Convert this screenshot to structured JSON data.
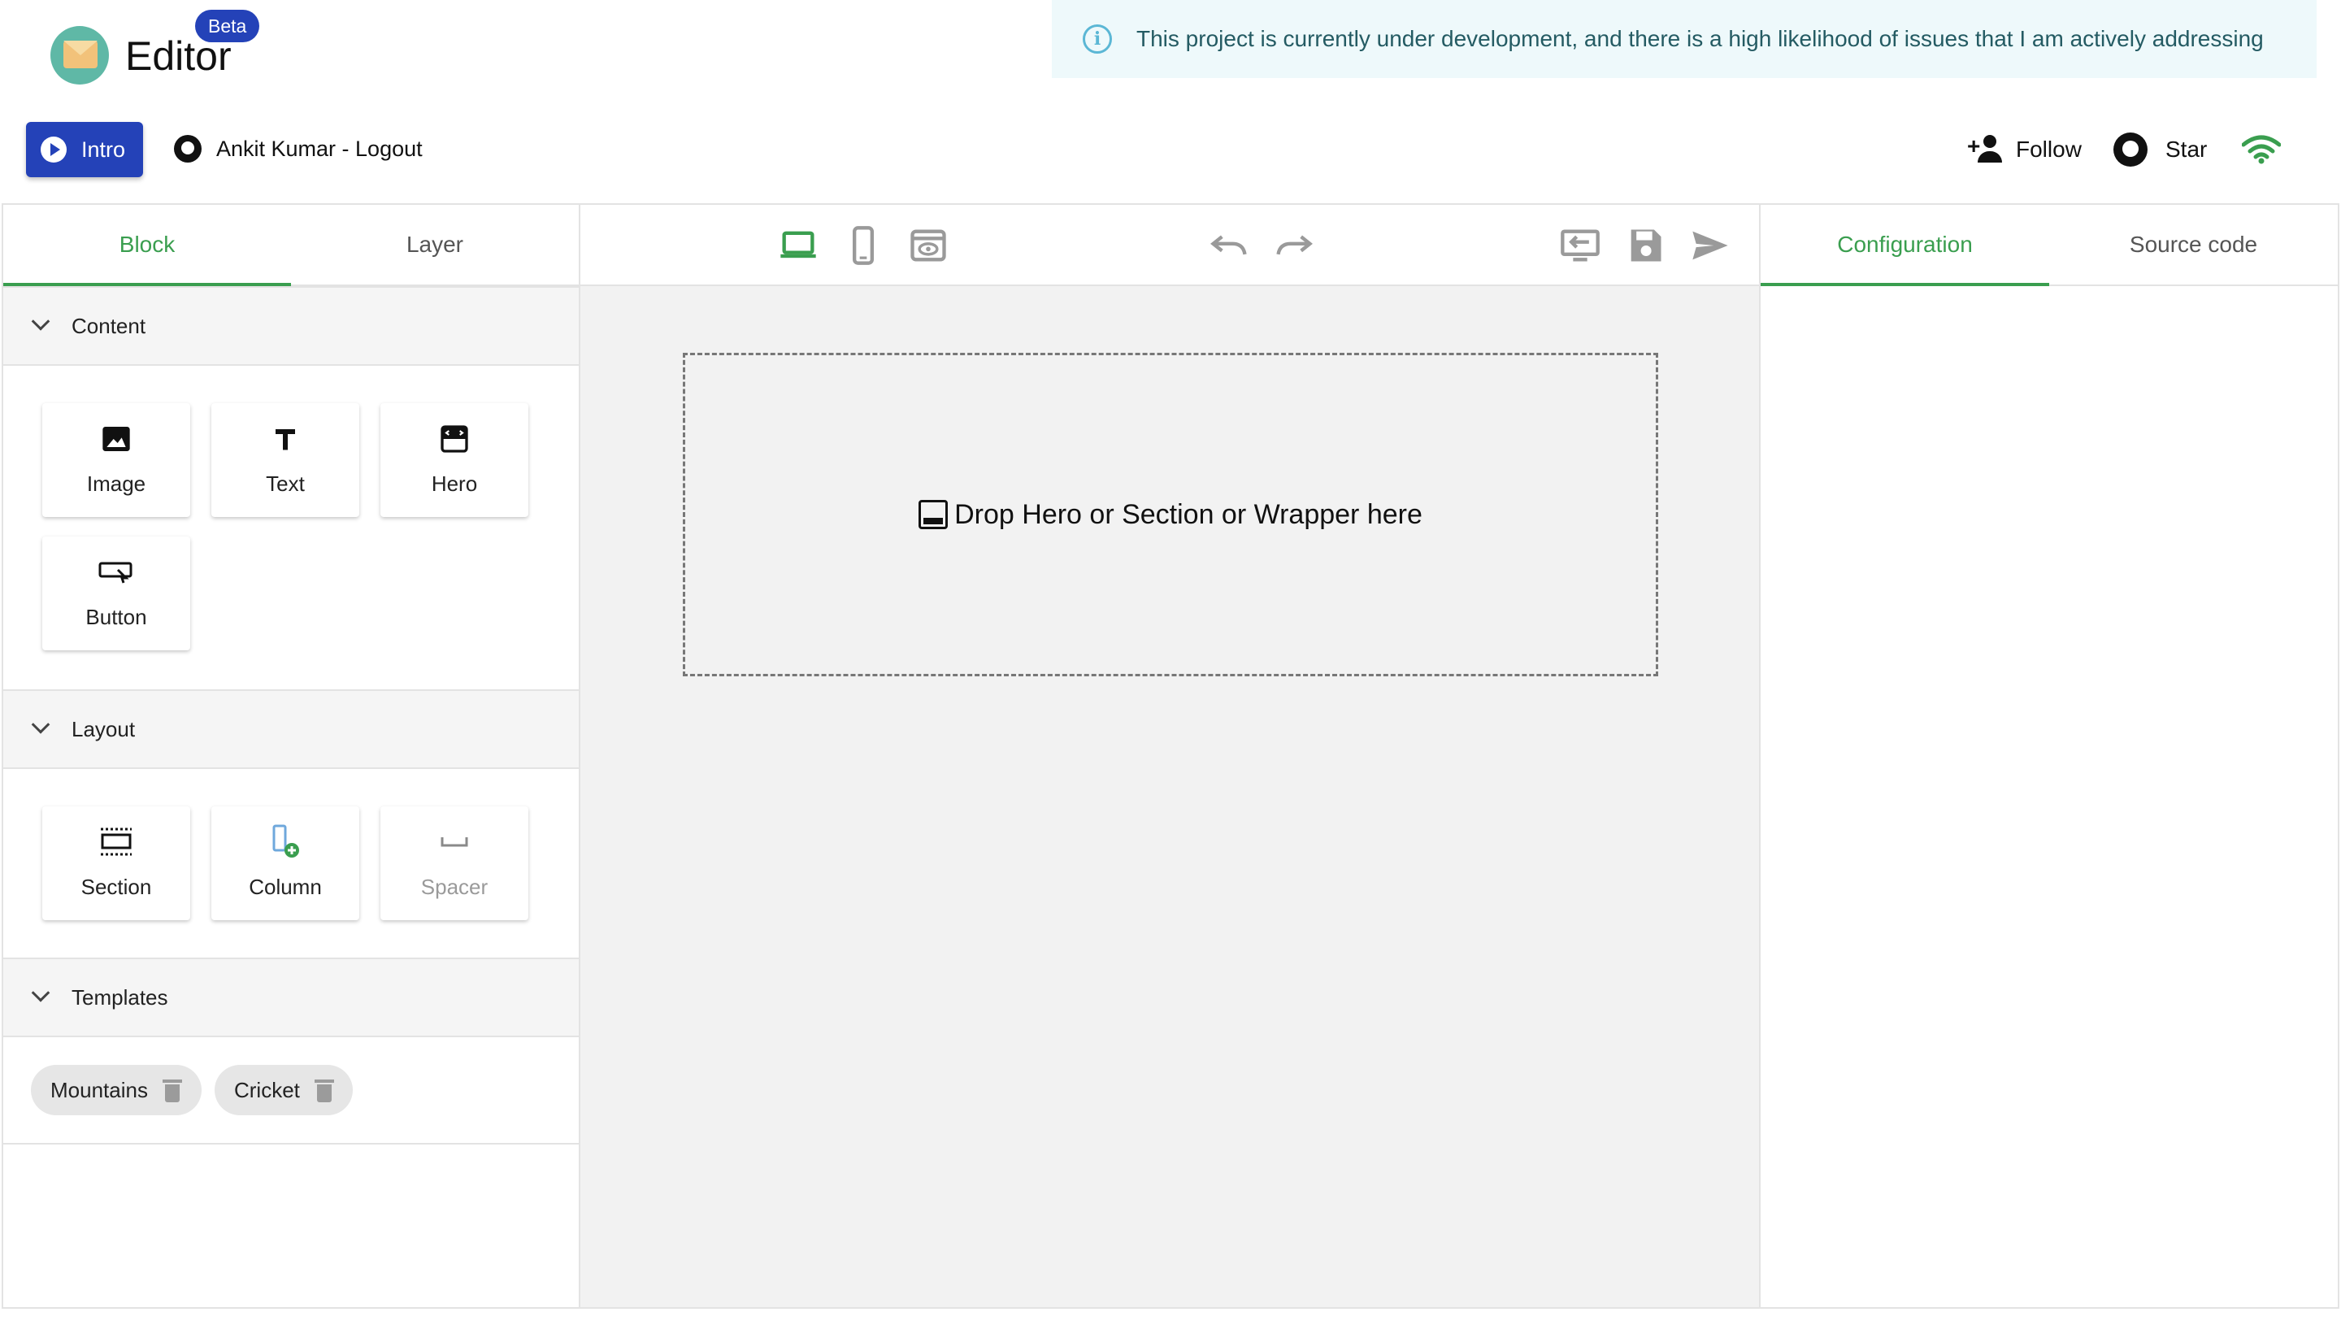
{
  "header": {
    "app_title": "Editor",
    "beta_badge": "Beta",
    "banner_text": "This project is currently under development, and there is a high likelihood of issues that I am actively addressing",
    "intro_label": "Intro",
    "user_link": "Ankit Kumar - Logout",
    "follow_label": "Follow",
    "star_label": "Star"
  },
  "left_panel": {
    "tabs": [
      {
        "label": "Block",
        "active": true
      },
      {
        "label": "Layer",
        "active": false
      }
    ],
    "sections": {
      "content": {
        "label": "Content",
        "items": [
          {
            "label": "Image",
            "icon": "image-icon"
          },
          {
            "label": "Text",
            "icon": "text-icon"
          },
          {
            "label": "Hero",
            "icon": "hero-icon"
          },
          {
            "label": "Button",
            "icon": "button-icon"
          }
        ]
      },
      "layout": {
        "label": "Layout",
        "items": [
          {
            "label": "Section",
            "icon": "section-icon"
          },
          {
            "label": "Column",
            "icon": "column-icon"
          },
          {
            "label": "Spacer",
            "icon": "spacer-icon",
            "disabled": true
          }
        ]
      },
      "templates": {
        "label": "Templates",
        "items": [
          {
            "label": "Mountains"
          },
          {
            "label": "Cricket"
          }
        ]
      }
    }
  },
  "canvas": {
    "toolbar_icons": [
      "laptop-icon",
      "mobile-icon",
      "preview-icon",
      "undo-icon",
      "redo-icon",
      "import-icon",
      "save-icon",
      "send-icon"
    ],
    "drop_zone_text": "Drop Hero or Section or Wrapper here"
  },
  "right_panel": {
    "tabs": [
      {
        "label": "Configuration",
        "active": true
      },
      {
        "label": "Source code",
        "active": false
      }
    ]
  },
  "colors": {
    "accent_green": "#3a9e4f",
    "brand_blue": "#2442b8",
    "banner_bg": "#eef9fb",
    "info_blue": "#5bb7d5"
  }
}
